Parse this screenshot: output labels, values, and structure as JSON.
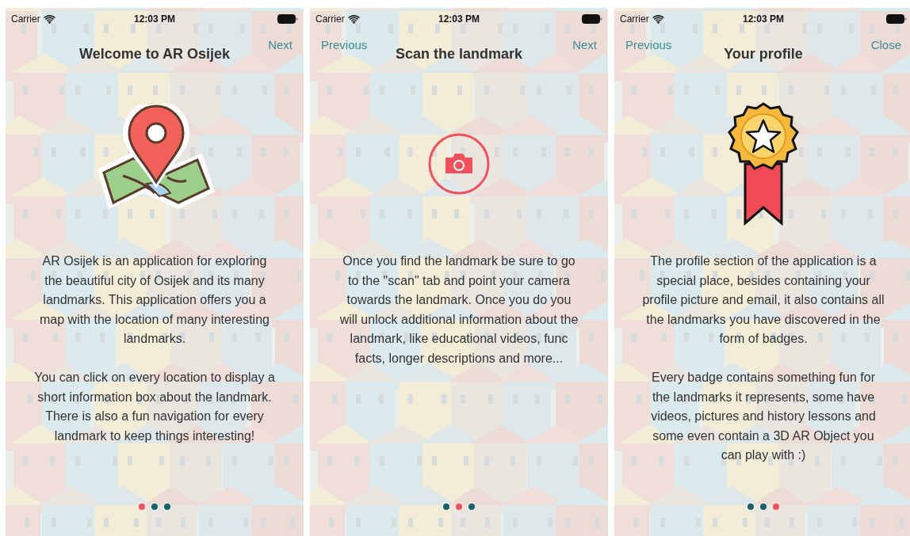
{
  "screens": [
    {
      "status_bar": {
        "carrier": "Carrier",
        "time": "12:03 PM"
      },
      "nav": {
        "next": "Next"
      },
      "title": "Welcome to AR Osijek",
      "illustration": {
        "kind": "map-pin"
      },
      "paragraphs": [
        "AR Osijek is an application for exploring the beautiful city of Osijek and its many landmarks. This application offers you a map with the location of many interesting landmarks.",
        "You can click on every location to display a short information box about the landmark. There is also a fun navigation for every landmark to keep things interesting!"
      ],
      "dots": [
        {
          "selected": true
        },
        {
          "selected": false
        },
        {
          "selected": false
        }
      ]
    },
    {
      "status_bar": {
        "carrier": "Carrier",
        "time": "12:03 PM"
      },
      "nav": {
        "previous": "Previous",
        "next": "Next"
      },
      "title": "Scan the landmark",
      "illustration": {
        "kind": "camera"
      },
      "paragraphs": [
        "Once you find the landmark be sure to go to the \"scan\" tab and point your camera towards the landmark. Once you do you will unlock additional information about the landmark, like educational videos, func facts, longer descriptions and more..."
      ],
      "dots": [
        {
          "selected": false
        },
        {
          "selected": true
        },
        {
          "selected": false
        }
      ]
    },
    {
      "status_bar": {
        "carrier": "Carrier",
        "time": "12:03 PM"
      },
      "nav": {
        "previous": "Previous",
        "next": "Close"
      },
      "title": "Your profile",
      "illustration": {
        "kind": "badge"
      },
      "paragraphs": [
        "The profile section of the application is a special place, besides containing your profile picture and email, it also contains all the landmarks you have discovered in the form of badges.",
        "Every badge contains something fun for the landmarks it represents, some have videos, pictures and history lessons and some even contain a 3D AR Object you can play with :)"
      ],
      "dots": [
        {
          "selected": false
        },
        {
          "selected": false
        },
        {
          "selected": true
        }
      ]
    }
  ]
}
